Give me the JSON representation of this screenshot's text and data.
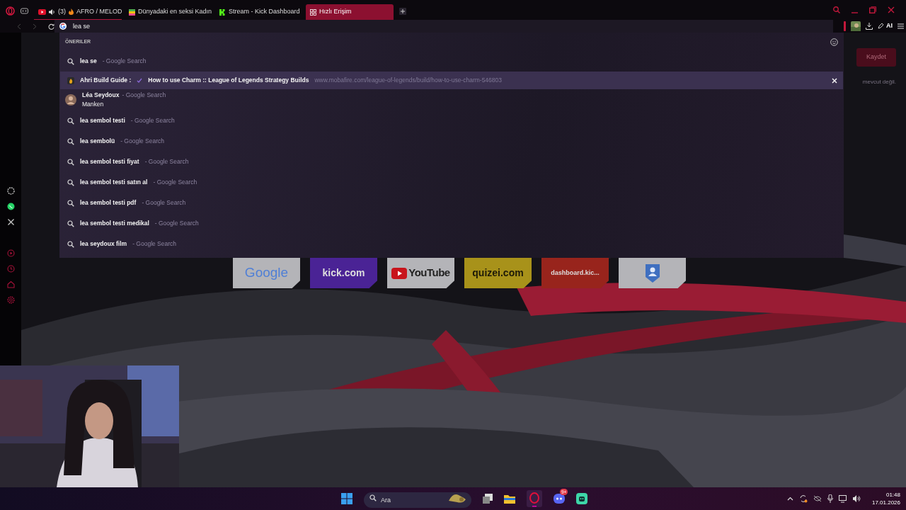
{
  "tabs": [
    {
      "kind": "media",
      "prefix": "(3)",
      "title": "AFRO / MELOD",
      "selected": false
    },
    {
      "kind": "page",
      "title": "Dünyadaki en seksi Kadın",
      "selected": false
    },
    {
      "kind": "kick",
      "title": "Stream - Kick Dashboard",
      "selected": false
    },
    {
      "kind": "speed-dial",
      "title": "Hızlı Erişim",
      "selected": true
    }
  ],
  "address_bar": {
    "value": "lea se"
  },
  "toolbar": {
    "ai_label": "AI"
  },
  "suggestions": {
    "heading": "ÖNERILER",
    "items": [
      {
        "kind": "search",
        "text": "**lea se**",
        "source": "- Google Search",
        "selected": false
      },
      {
        "kind": "site",
        "title": "Ahri Build Guide :",
        "subtitle": "How to use Charm :: League of Legends Strategy Builds",
        "url": "www.mobafire.com/league-of-legends/build/how-to-use-charm-546803",
        "selected": true
      },
      {
        "kind": "entity",
        "text": "Léa Seydoux",
        "source": "- Google Search",
        "description": "Manken",
        "selected": false
      },
      {
        "kind": "search",
        "text": "**lea se**mbol testi",
        "source": "- Google Search",
        "selected": false
      },
      {
        "kind": "search",
        "text": "**lea se**mbolü",
        "source": "- Google Search",
        "selected": false
      },
      {
        "kind": "search",
        "text": "**lea se**mbol testi fiyat",
        "source": "- Google Search",
        "selected": false
      },
      {
        "kind": "search",
        "text": "**lea se**mbol testi satın al",
        "source": "- Google Search",
        "selected": false
      },
      {
        "kind": "search",
        "text": "**lea se**mbol testi pdf",
        "source": "- Google Search",
        "selected": false
      },
      {
        "kind": "search",
        "text": "**lea se**mbol testi medikal",
        "source": "- Google Search",
        "selected": false
      },
      {
        "kind": "search",
        "text": "**lea se**ydoux film",
        "source": "- Google Search",
        "selected": false
      }
    ]
  },
  "background_page": {
    "save_button": "Kaydet",
    "note": "mevcut değil."
  },
  "speed_dial": [
    {
      "kind": "google",
      "label": "Google",
      "color": "#b4b4b8"
    },
    {
      "kind": "text",
      "label": "kick.com",
      "color": "#4a2395"
    },
    {
      "kind": "youtube",
      "label": "YouTube",
      "color": "#b4b4b8"
    },
    {
      "kind": "text",
      "label": "quizei.com",
      "color": "#a8921a"
    },
    {
      "kind": "text",
      "label": "dashboard.kic...",
      "color": "#98241c"
    },
    {
      "kind": "profile",
      "color": "#b4b4b8"
    }
  ],
  "taskbar": {
    "search_placeholder": "Ara",
    "discord_badge": "9+",
    "time": "01:48",
    "date": "17.01.2026"
  }
}
